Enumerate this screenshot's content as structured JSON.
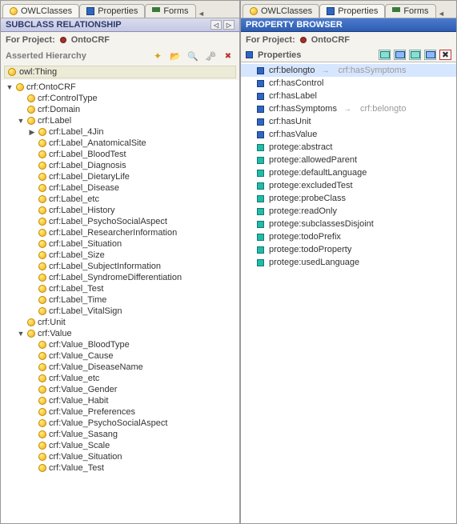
{
  "tabs": {
    "owl": "OWLClasses",
    "properties": "Properties",
    "forms": "Forms"
  },
  "left": {
    "header": "SUBCLASS RELATIONSHIP",
    "project_label": "For Project:",
    "project_name": "OntoCRF",
    "hierarchy_label": "Asserted Hierarchy",
    "root": "owl:Thing",
    "tree": {
      "n0": "crf:OntoCRF",
      "n0_0": "crf:ControlType",
      "n0_1": "crf:Domain",
      "n0_2": "crf:Label",
      "n0_2_0": "crf:Label_4Jin",
      "n0_2_1": "crf:Label_AnatomicalSite",
      "n0_2_2": "crf:Label_BloodTest",
      "n0_2_3": "crf:Label_Diagnosis",
      "n0_2_4": "crf:Label_DietaryLife",
      "n0_2_5": "crf:Label_Disease",
      "n0_2_6": "crf:Label_etc",
      "n0_2_7": "crf:Label_History",
      "n0_2_8": "crf:Label_PsychoSocialAspect",
      "n0_2_9": "crf:Label_ResearcherInformation",
      "n0_2_10": "crf:Label_Situation",
      "n0_2_11": "crf:Label_Size",
      "n0_2_12": "crf:Label_SubjectInformation",
      "n0_2_13": "crf:Label_SyndromeDifferentiation",
      "n0_2_14": "crf:Label_Test",
      "n0_2_15": "crf:Label_Time",
      "n0_2_16": "crf:Label_VitalSign",
      "n0_3": "crf:Unit",
      "n0_4": "crf:Value",
      "n0_4_0": "crf:Value_BloodType",
      "n0_4_1": "crf:Value_Cause",
      "n0_4_2": "crf:Value_DiseaseName",
      "n0_4_3": "crf:Value_etc",
      "n0_4_4": "crf:Value_Gender",
      "n0_4_5": "crf:Value_Habit",
      "n0_4_6": "crf:Value_Preferences",
      "n0_4_7": "crf:Value_PsychoSocialAspect",
      "n0_4_8": "crf:Value_Sasang",
      "n0_4_9": "crf:Value_Scale",
      "n0_4_10": "crf:Value_Situation",
      "n0_4_11": "crf:Value_Test"
    }
  },
  "right": {
    "header": "PROPERTY BROWSER",
    "project_label": "For Project:",
    "project_name": "OntoCRF",
    "list_header": "Properties",
    "properties": {
      "p0": {
        "name": "crf:belongto",
        "inverse": "crf:hasSymptoms",
        "kind": "obj",
        "sel": true
      },
      "p1": {
        "name": "crf:hasControl",
        "kind": "obj"
      },
      "p2": {
        "name": "crf:hasLabel",
        "kind": "obj"
      },
      "p3": {
        "name": "crf:hasSymptoms",
        "inverse": "crf:belongto",
        "kind": "obj"
      },
      "p4": {
        "name": "crf:hasUnit",
        "kind": "obj"
      },
      "p5": {
        "name": "crf:hasValue",
        "kind": "obj"
      },
      "p6": {
        "name": "protege:abstract",
        "kind": "ann"
      },
      "p7": {
        "name": "protege:allowedParent",
        "kind": "ann"
      },
      "p8": {
        "name": "protege:defaultLanguage",
        "kind": "ann"
      },
      "p9": {
        "name": "protege:excludedTest",
        "kind": "ann"
      },
      "p10": {
        "name": "protege:probeClass",
        "kind": "ann"
      },
      "p11": {
        "name": "protege:readOnly",
        "kind": "ann"
      },
      "p12": {
        "name": "protege:subclassesDisjoint",
        "kind": "ann"
      },
      "p13": {
        "name": "protege:todoPrefix",
        "kind": "ann"
      },
      "p14": {
        "name": "protege:todoProperty",
        "kind": "ann"
      },
      "p15": {
        "name": "protege:usedLanguage",
        "kind": "ann"
      }
    }
  }
}
